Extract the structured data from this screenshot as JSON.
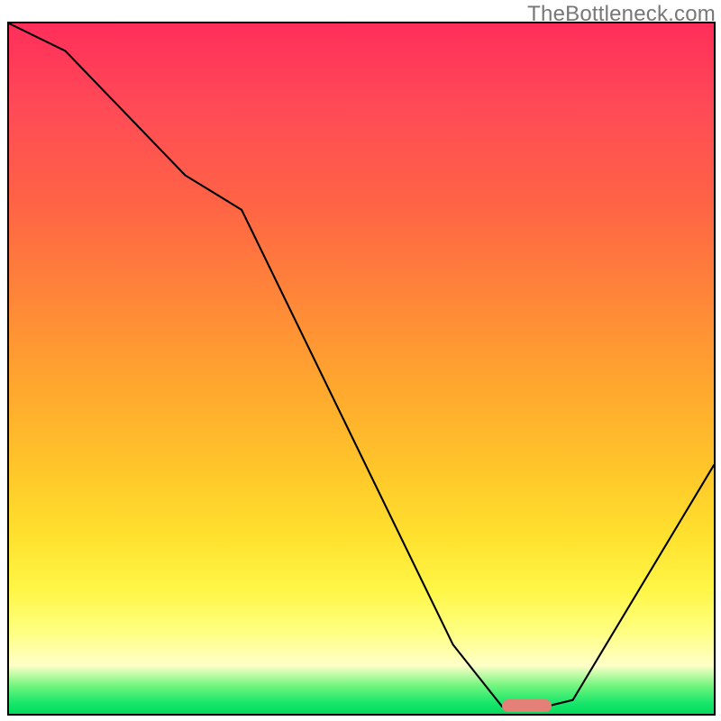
{
  "watermark": "TheBottleneck.com",
  "colors": {
    "border": "#000000",
    "curve": "#000000",
    "marker": "#e58078",
    "watermark": "#777777"
  },
  "chart_data": {
    "type": "line",
    "title": "",
    "xlabel": "",
    "ylabel": "",
    "xlim": [
      0,
      100
    ],
    "ylim": [
      0,
      100
    ],
    "series": [
      {
        "name": "bottleneck-curve",
        "x": [
          0,
          8,
          25,
          33,
          63,
          70,
          76,
          80,
          100
        ],
        "values": [
          100,
          96,
          78,
          73,
          10,
          1,
          1,
          2,
          36
        ]
      }
    ],
    "annotations": [
      {
        "name": "optimal-marker",
        "x_start": 70,
        "x_end": 77,
        "y": 0,
        "color": "#e58078"
      }
    ],
    "grid": false,
    "legend": false,
    "background_gradient": {
      "orientation": "vertical",
      "stops": [
        {
          "pos": 0,
          "color": "#ff2e5a"
        },
        {
          "pos": 0.12,
          "color": "#ff4a57"
        },
        {
          "pos": 0.25,
          "color": "#ff6146"
        },
        {
          "pos": 0.35,
          "color": "#ff7a3d"
        },
        {
          "pos": 0.47,
          "color": "#ff9932"
        },
        {
          "pos": 0.57,
          "color": "#ffb22c"
        },
        {
          "pos": 0.66,
          "color": "#ffca2a"
        },
        {
          "pos": 0.74,
          "color": "#ffe02e"
        },
        {
          "pos": 0.82,
          "color": "#fff646"
        },
        {
          "pos": 0.88,
          "color": "#ffff80"
        },
        {
          "pos": 0.93,
          "color": "#ffffc8"
        },
        {
          "pos": 0.96,
          "color": "#6ff57d"
        },
        {
          "pos": 0.985,
          "color": "#16e66a"
        },
        {
          "pos": 1.0,
          "color": "#06db5f"
        }
      ]
    }
  }
}
